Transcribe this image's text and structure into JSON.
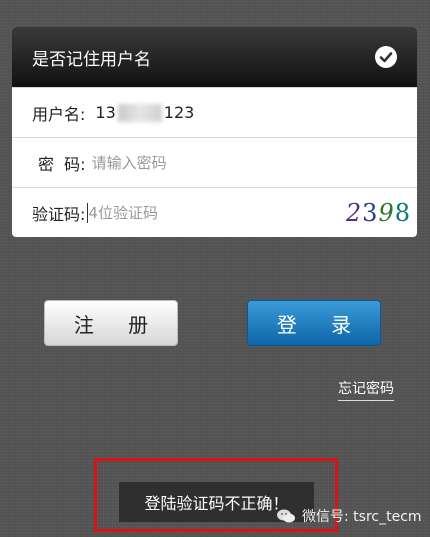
{
  "remember": {
    "label": "是否记住用户名",
    "checked": true
  },
  "username": {
    "label": "用户名:",
    "value_prefix": "13",
    "value_suffix": "123"
  },
  "password": {
    "label": "密  码:",
    "placeholder": "请输入密码"
  },
  "captcha": {
    "label": "验证码:",
    "placeholder": "4位验证码",
    "image_text": "2398"
  },
  "buttons": {
    "register": "注 册",
    "login": "登 录"
  },
  "forgot": "忘记密码",
  "toast": "登陆验证码不正确！",
  "watermark": "微信号: tsrc_tecm"
}
